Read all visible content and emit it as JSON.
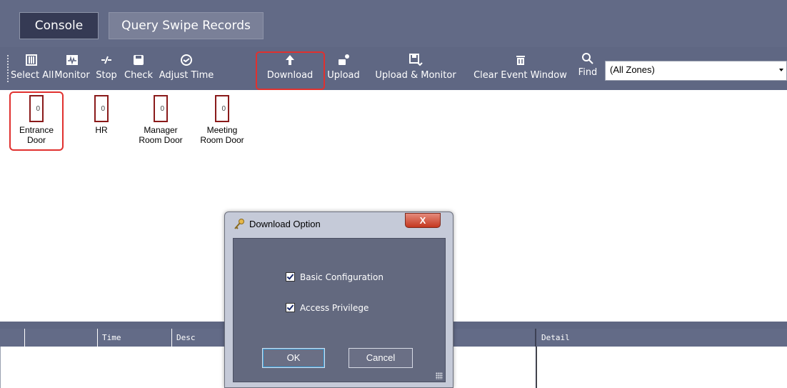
{
  "tabs": {
    "console": "Console",
    "query": "Query Swipe Records"
  },
  "toolbar": {
    "select_all": "Select All",
    "monitor": "Monitor",
    "stop": "Stop",
    "check": "Check",
    "adjust_time": "Adjust Time",
    "download": "Download",
    "upload": "Upload",
    "upload_monitor": "Upload & Monitor",
    "clear_event": "Clear Event Window",
    "find": "Find",
    "zone_value": "(All Zones)"
  },
  "doors": [
    {
      "line1": "Entrance",
      "line2": "Door",
      "count": "0"
    },
    {
      "line1": "HR",
      "line2": "",
      "count": "0"
    },
    {
      "line1": "Manager",
      "line2": "Room Door",
      "count": "0"
    },
    {
      "line1": "Meeting",
      "line2": "Room Door",
      "count": "0"
    }
  ],
  "grid": {
    "time": "Time",
    "desc": "Desc",
    "detail": "Detail"
  },
  "dialog": {
    "title": "Download Option",
    "close": "X",
    "opt1": "Basic Configuration",
    "opt2": "Access Privilege",
    "ok": "OK",
    "cancel": "Cancel"
  },
  "colors": {
    "highlight": "#e0312f",
    "toolbar": "#5f6783",
    "door_frame": "#8a1a1a"
  }
}
